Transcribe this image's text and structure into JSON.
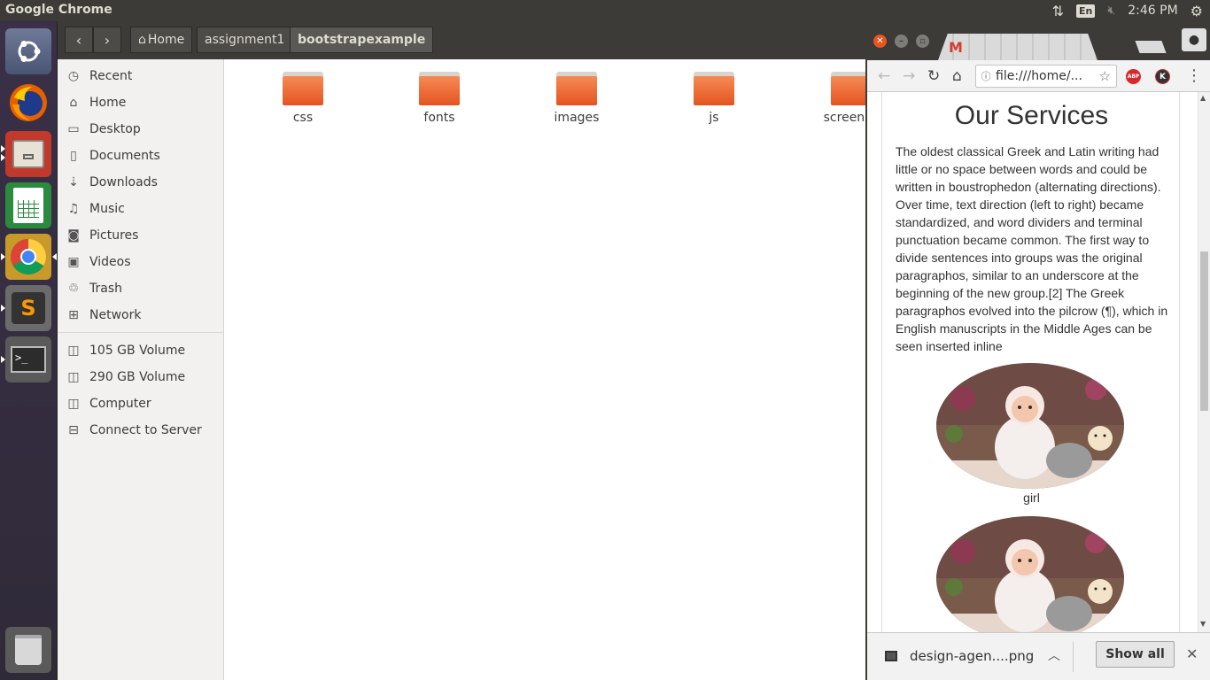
{
  "top_panel": {
    "app_title": "Google Chrome",
    "keyboard_layout": "En",
    "clock": "2:46 PM"
  },
  "launcher": {
    "items": [
      "ubuntu-dash",
      "firefox",
      "files",
      "libreoffice-calc",
      "chrome",
      "sublime-text",
      "terminal",
      "trash"
    ]
  },
  "file_manager": {
    "breadcrumbs": [
      "Home",
      "assignment1",
      "bootstrapexample"
    ],
    "sidebar": [
      {
        "label": "Recent",
        "icon": "clock-icon"
      },
      {
        "label": "Home",
        "icon": "home-icon"
      },
      {
        "label": "Desktop",
        "icon": "folder-icon"
      },
      {
        "label": "Documents",
        "icon": "document-icon"
      },
      {
        "label": "Downloads",
        "icon": "download-icon"
      },
      {
        "label": "Music",
        "icon": "music-icon"
      },
      {
        "label": "Pictures",
        "icon": "camera-icon"
      },
      {
        "label": "Videos",
        "icon": "video-icon"
      },
      {
        "label": "Trash",
        "icon": "trash-icon"
      },
      {
        "label": "Network",
        "icon": "network-icon"
      },
      {
        "label": "105 GB Volume",
        "icon": "drive-icon"
      },
      {
        "label": "290 GB Volume",
        "icon": "drive-icon"
      },
      {
        "label": "Computer",
        "icon": "drive-icon"
      },
      {
        "label": "Connect to Server",
        "icon": "server-icon"
      }
    ],
    "folders": [
      "css",
      "fonts",
      "images",
      "js",
      "screensh"
    ]
  },
  "chrome": {
    "address": "file:///home/...",
    "page": {
      "title": "Our Services",
      "paragraph": "The oldest classical Greek and Latin writing had little or no space between words and could be written in boustrophedon (alternating directions). Over time, text direction (left to right) became standardized, and word dividers and terminal punctuation became common. The first way to divide sentences into groups was the original paragraphos, similar to an underscore at the beginning of the new group.[2] The Greek paragraphos evolved into the pilcrow (¶), which in English manuscripts in the Middle Ages can be seen inserted inline",
      "image_caption": "girl"
    },
    "download": {
      "filename": "design-agen....png",
      "show_all_label": "Show all"
    },
    "extensions": {
      "abp_label": "ABP",
      "k_label": "K"
    }
  }
}
